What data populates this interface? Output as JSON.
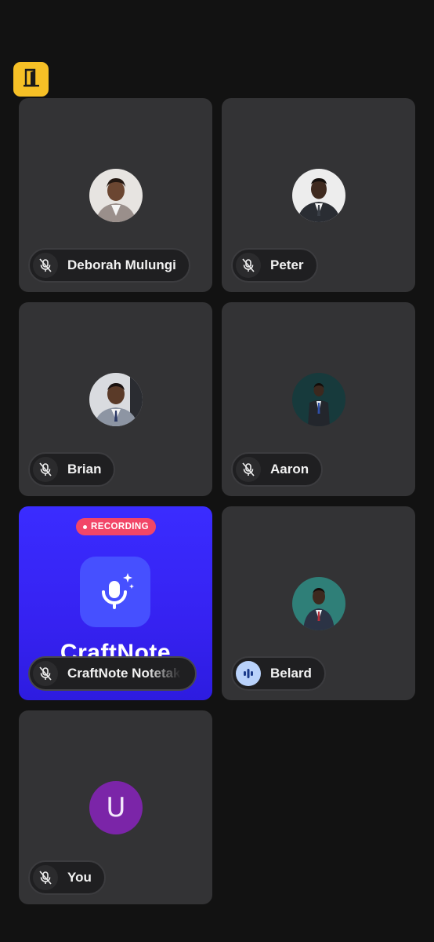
{
  "toolbar": {
    "leave_icon": "door-exit-icon",
    "leave_color": "#f6c026"
  },
  "participants": [
    {
      "name": "Deborah Mulungi",
      "mic": "muted"
    },
    {
      "name": "Peter",
      "mic": "muted"
    },
    {
      "name": "Brian",
      "mic": "muted"
    },
    {
      "name": "Aaron",
      "mic": "muted"
    },
    {
      "name": "CraftNote Notetak",
      "mic": "muted"
    },
    {
      "name": "Belard",
      "mic": "speaking"
    },
    {
      "name": "You",
      "mic": "muted",
      "avatar_letter": "U"
    }
  ],
  "recorder": {
    "badge": "RECORDING",
    "app_name": "CraftNote",
    "badge_color": "#f24668",
    "tile_color": "#3a2cff"
  },
  "icons": {
    "muted": "mic-off-icon",
    "speaking": "audio-level-icon"
  }
}
